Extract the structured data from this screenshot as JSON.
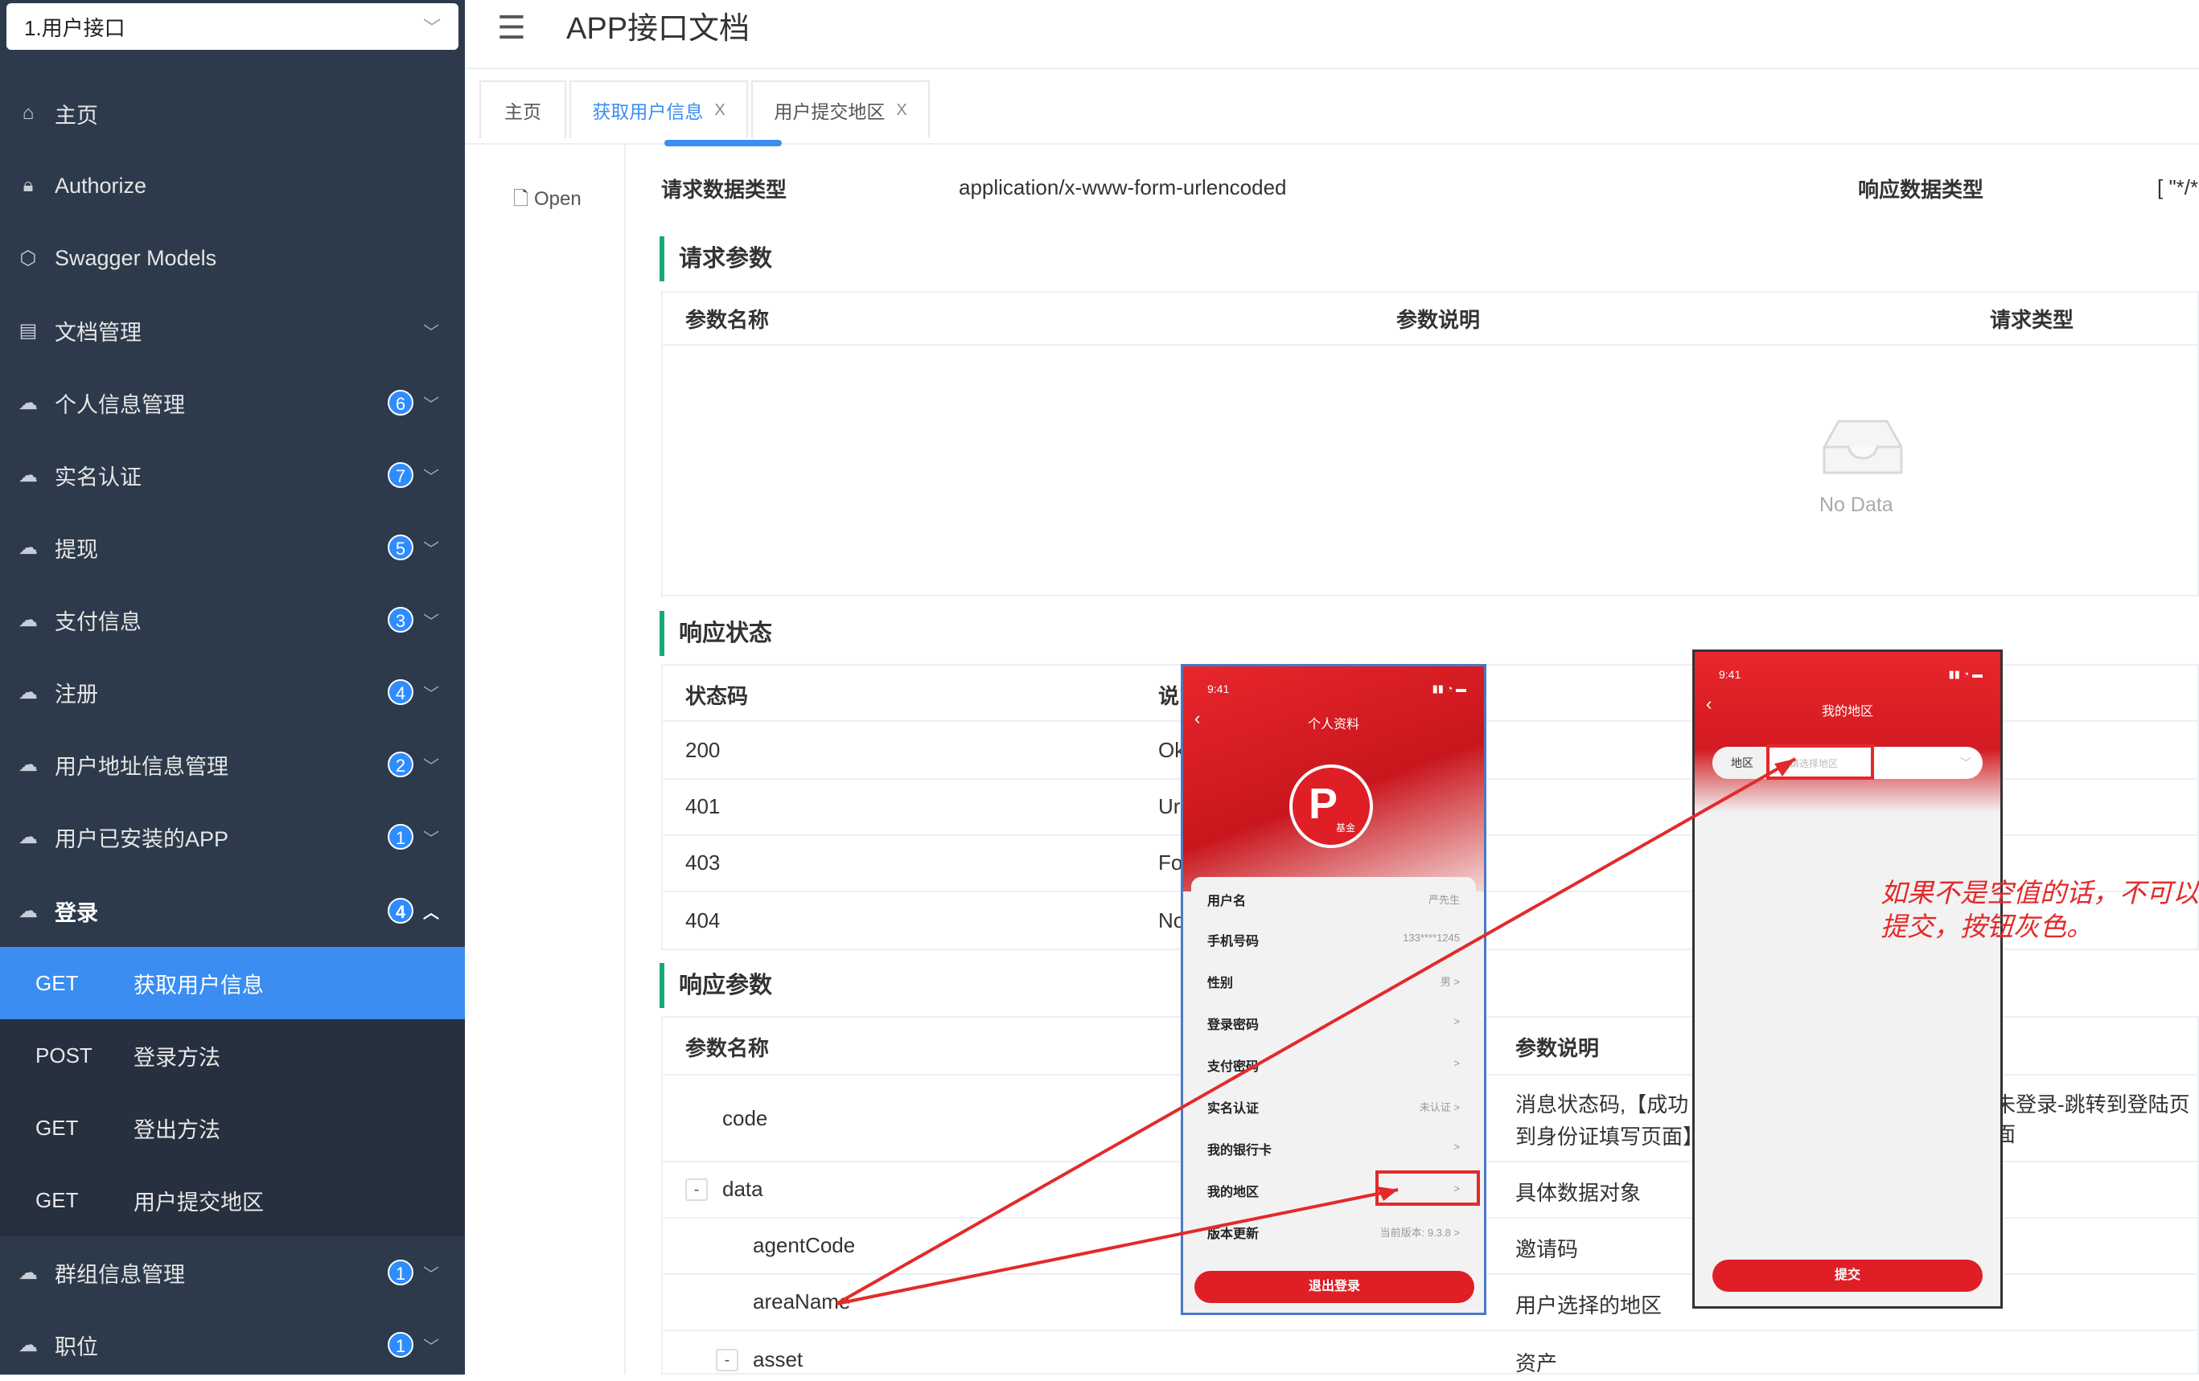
{
  "sidebar": {
    "doc_select": {
      "value": "1.用户接口"
    },
    "items": [
      {
        "label": "主页",
        "icon": "home-icon"
      },
      {
        "label": "Authorize",
        "icon": "lock-icon"
      },
      {
        "label": "Swagger Models",
        "icon": "cube-icon"
      },
      {
        "label": "文档管理",
        "icon": "document-icon"
      },
      {
        "label": "个人信息管理",
        "badge": "6"
      },
      {
        "label": "实名认证",
        "badge": "7"
      },
      {
        "label": "提现",
        "badge": "5"
      },
      {
        "label": "支付信息",
        "badge": "3"
      },
      {
        "label": "注册",
        "badge": "4"
      },
      {
        "label": "用户地址信息管理",
        "badge": "2"
      },
      {
        "label": "用户已安装的APP",
        "badge": "1"
      },
      {
        "label": "登录",
        "badge": "4"
      },
      {
        "label": "群组信息管理",
        "badge": "1"
      },
      {
        "label": "职位",
        "badge": "1"
      }
    ],
    "login_sub": [
      {
        "method": "GET",
        "label": "获取用户信息",
        "active": true
      },
      {
        "method": "POST",
        "label": "登录方法"
      },
      {
        "method": "GET",
        "label": "登出方法"
      },
      {
        "method": "GET",
        "label": "用户提交地区"
      }
    ]
  },
  "header": {
    "title": "APP接口文档"
  },
  "tabs": [
    {
      "label": "主页"
    },
    {
      "label": "获取用户信息",
      "close": "X"
    },
    {
      "label": "用户提交地区",
      "close": "X"
    }
  ],
  "open_label": "Open",
  "request_info": {
    "req_type_label": "请求数据类型",
    "req_type_value": "application/x-www-form-urlencoded",
    "resp_type_label": "响应数据类型",
    "resp_type_value": "[ \"*/*"
  },
  "request_params": {
    "title": "请求参数",
    "headers": [
      "参数名称",
      "参数说明",
      "请求类型"
    ],
    "empty": "No Data"
  },
  "response_status": {
    "title": "响应状态",
    "headers": [
      "状态码",
      "说"
    ],
    "rows": [
      {
        "code": "200",
        "desc": "Ok"
      },
      {
        "code": "401",
        "desc": "Ur"
      },
      {
        "code": "403",
        "desc": "Fo"
      },
      {
        "code": "404",
        "desc": "No"
      }
    ]
  },
  "response_params": {
    "title": "响应参数",
    "headers": [
      "参数名称",
      "参数说明"
    ],
    "rows": [
      {
        "name": "code",
        "desc_line1": "消息状态码,【成功",
        "desc_tail": "未登录-跳转到登陆页面",
        "desc_line2": "到身份证填写页面】"
      },
      {
        "name": "data",
        "toggle": "-",
        "desc_line1": "具体数据对象"
      },
      {
        "name": "agentCode",
        "desc_line1": "邀请码"
      },
      {
        "name": "areaName",
        "desc_line1": "用户选择的地区"
      },
      {
        "name": "asset",
        "toggle": "-",
        "desc_line1": "资产"
      }
    ]
  },
  "phone1": {
    "time": "9:41",
    "title": "个人资料",
    "logo_text": "基金",
    "rows": [
      {
        "k": "用户名",
        "v": "严先生"
      },
      {
        "k": "手机号码",
        "v": "133****1245"
      },
      {
        "k": "性别",
        "v": "男 >"
      },
      {
        "k": "登录密码",
        "v": ">"
      },
      {
        "k": "支付密码",
        "v": ">"
      },
      {
        "k": "实名认证",
        "v": "未认证 >"
      },
      {
        "k": "我的银行卡",
        "v": ">"
      },
      {
        "k": "我的地区",
        "v": ">"
      },
      {
        "k": "版本更新",
        "v": "当前版本: 9.3.8 >"
      }
    ],
    "logout": "退出登录"
  },
  "phone2": {
    "time": "9:41",
    "title": "我的地区",
    "field_label": "地区",
    "placeholder": "请选择地区",
    "submit": "提交"
  },
  "annotation": "如果不是空值的话，不可以提交，按钮灰色。",
  "colors": {
    "sidebar": "#2d3a4b",
    "accent": "#3b8df1",
    "section_bar": "#19a974",
    "annotation": "#e32a2a",
    "phone_red": "#e01e26"
  }
}
